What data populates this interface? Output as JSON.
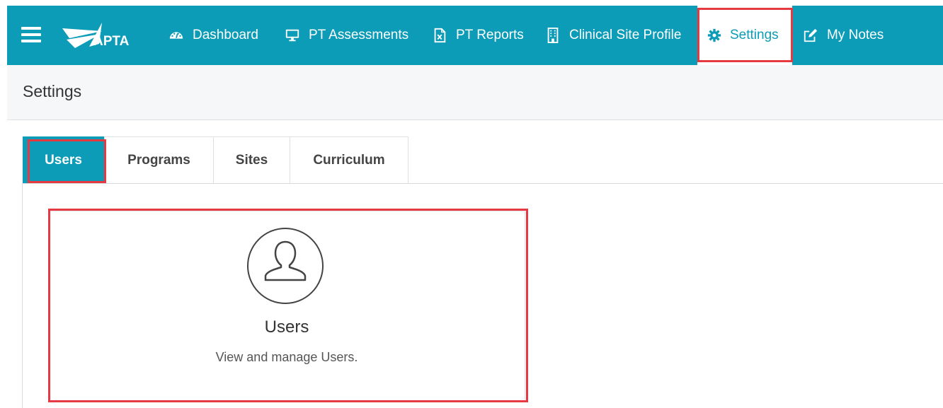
{
  "brand": {
    "logo_text": "APTA"
  },
  "nav": {
    "items": [
      {
        "label": "Dashboard",
        "icon": "dashboard-gauge-icon"
      },
      {
        "label": "PT Assessments",
        "icon": "monitor-icon"
      },
      {
        "label": "PT Reports",
        "icon": "excel-file-icon"
      },
      {
        "label": "Clinical Site Profile",
        "icon": "building-icon"
      },
      {
        "label": "Settings",
        "icon": "gear-icon",
        "active": true
      },
      {
        "label": "My Notes",
        "icon": "edit-note-icon"
      }
    ]
  },
  "page": {
    "title": "Settings"
  },
  "tabs": [
    {
      "label": "Users",
      "active": true
    },
    {
      "label": "Programs"
    },
    {
      "label": "Sites"
    },
    {
      "label": "Curriculum"
    }
  ],
  "card": {
    "title": "Users",
    "description": "View and manage Users.",
    "icon": "user-circle-icon"
  },
  "colors": {
    "brand": "#0d9cb8",
    "highlight": "#e53a41"
  }
}
